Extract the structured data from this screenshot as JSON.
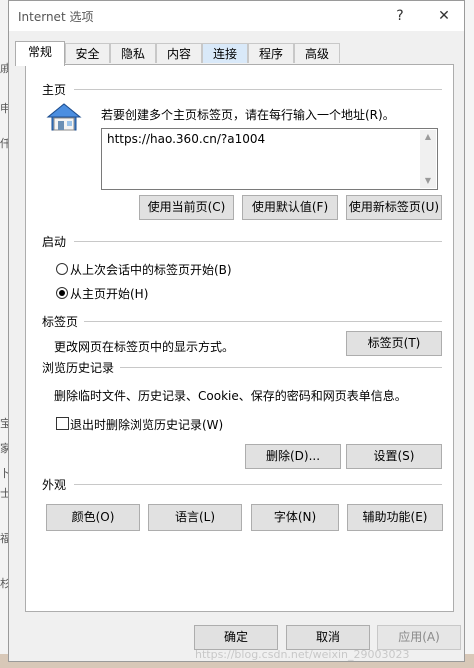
{
  "window": {
    "title": "Internet 选项",
    "help_label": "?",
    "close_label": "✕"
  },
  "tabs": [
    {
      "label": "常规",
      "active": true
    },
    {
      "label": "安全"
    },
    {
      "label": "隐私"
    },
    {
      "label": "内容"
    },
    {
      "label": "连接"
    },
    {
      "label": "程序"
    },
    {
      "label": "高级"
    }
  ],
  "home": {
    "section": "主页",
    "hint": "若要创建多个主页标签页，请在每行输入一个地址(R)。",
    "url": "https://hao.360.cn/?a1004",
    "icon": "house-icon",
    "btn_current": "使用当前页(C)",
    "btn_default": "使用默认值(F)",
    "btn_newtab": "使用新标签页(U)"
  },
  "startup": {
    "section": "启动",
    "opt_last": "从上次会话中的标签页开始(B)",
    "opt_home": "从主页开始(H)",
    "selected": "opt_home"
  },
  "tabs_section": {
    "section": "标签页",
    "desc": "更改网页在标签页中的显示方式。",
    "button": "标签页(T)"
  },
  "history": {
    "section": "浏览历史记录",
    "desc": "删除临时文件、历史记录、Cookie、保存的密码和网页表单信息。",
    "checkbox_label": "退出时删除浏览历史记录(W)",
    "checked": false,
    "btn_delete": "删除(D)...",
    "btn_settings": "设置(S)"
  },
  "appearance": {
    "section": "外观",
    "btn_colors": "颜色(O)",
    "btn_languages": "语言(L)",
    "btn_fonts": "字体(N)",
    "btn_accessibility": "辅助功能(E)"
  },
  "footer": {
    "ok": "确定",
    "cancel": "取消",
    "apply": "应用(A)"
  },
  "watermark": "https://blog.csdn.net/weixin_29003023",
  "background": {
    "left_fragments": [
      "戚",
      "申",
      "仟",
      "宝",
      "家",
      "卜",
      "士",
      "福",
      "杉"
    ]
  }
}
